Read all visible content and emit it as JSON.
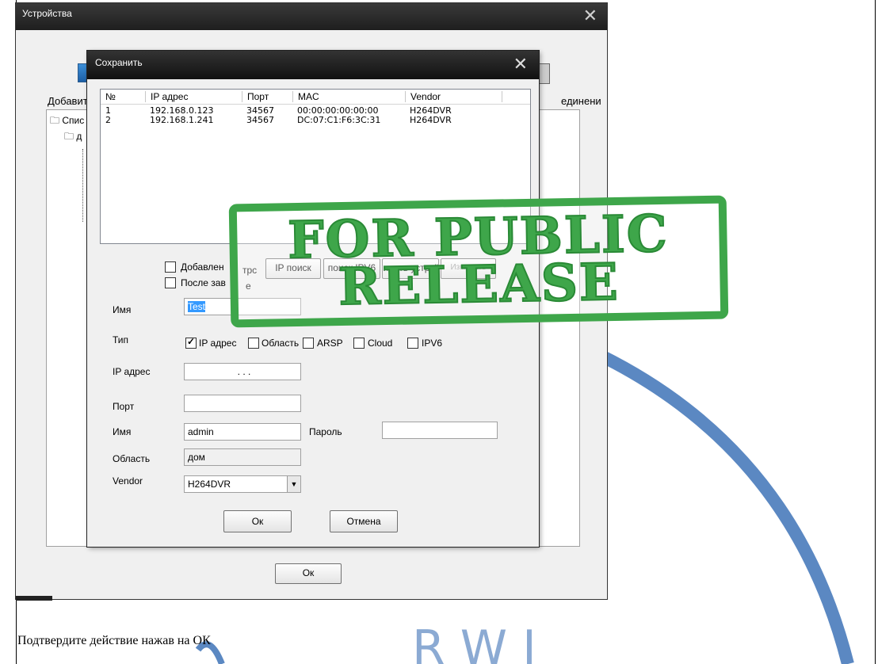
{
  "outer": {
    "title": "Устройства",
    "close": "✕",
    "add_label": "Добавит",
    "connect_label": "единени",
    "tree_root": "Спис",
    "tree_child": "д",
    "ok_label": "Ок"
  },
  "dialog": {
    "title": "Сохранить",
    "close": "✕",
    "columns": [
      "№",
      "IP адрес",
      "Порт",
      "MAC",
      "Vendor"
    ],
    "rows": [
      {
        "no": "1",
        "ip": "192.168.0.123",
        "port": "34567",
        "mac": "00:00:00:00:00:00",
        "vendor": "H264DVR"
      },
      {
        "no": "2",
        "ip": "192.168.1.241",
        "port": "34567",
        "mac": "DC:07:C1:F6:3C:31",
        "vendor": "H264DVR"
      }
    ],
    "add_checkbox_label": "Добавлен",
    "after_checkbox_label": "После зав",
    "trc_fragment": "трс",
    "e_fragment": "е",
    "ip_search_button": "IP поиск",
    "ipv6_search_button": "поиск IPV6",
    "add_device_button": "ивить устрої",
    "edit_button": "Изменить",
    "name_label": "Имя",
    "name_value": "Test",
    "type_label": "Тип",
    "type_options": [
      "IP адрес",
      "Область",
      "ARSP",
      "Cloud",
      "IPV6"
    ],
    "ip_label": "IP адрес",
    "ip_value": ".   .   .",
    "port_label": "Порт",
    "port_value": "",
    "user_label": "Имя",
    "user_value": "admin",
    "password_label": "Пароль",
    "password_value": "",
    "area_label": "Область",
    "area_value": "дом",
    "vendor_label": "Vendor",
    "vendor_value": "H264DVR",
    "ok_label": "Ок",
    "cancel_label": "Отмена"
  },
  "stamp": {
    "line1": "FOR PUBLIC",
    "line2": "RELEASE",
    "color": "#3ea64a"
  },
  "caption": "Подтвердите действие нажав на ОК",
  "watermark_color": "#5b88c2"
}
